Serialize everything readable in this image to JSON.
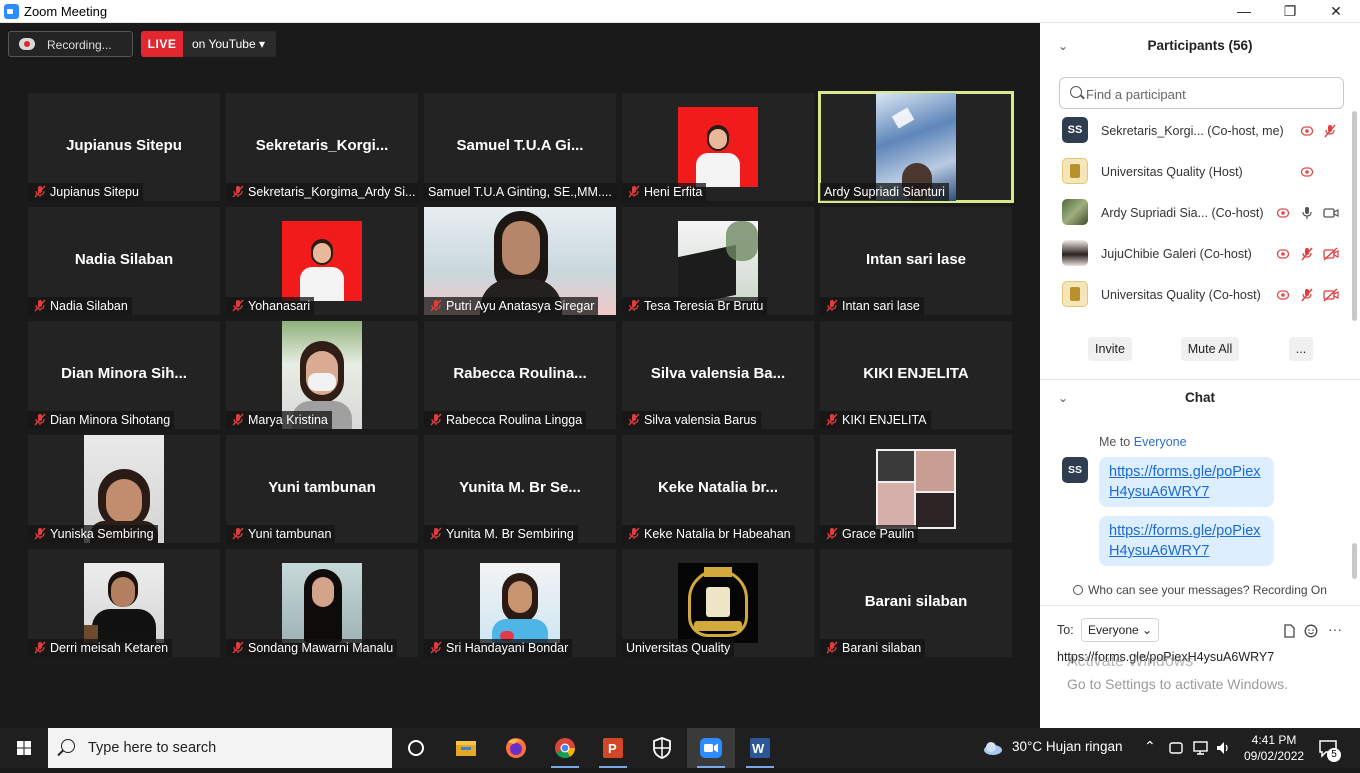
{
  "window": {
    "title": "Zoom Meeting",
    "minimize": "—",
    "maximize": "❐",
    "close": "✕"
  },
  "toolbar": {
    "recording_label": "Recording...",
    "live_badge": "LIVE",
    "live_target": "on YouTube ▾"
  },
  "tiles": [
    {
      "big": "Jupianus Sitepu",
      "label": "Jupianus Sitepu",
      "muted": true
    },
    {
      "big": "Sekretaris_Korgi...",
      "label": "Sekretaris_Korgima_Ardy Si...",
      "muted": true
    },
    {
      "big": "Samuel T.U.A Gi...",
      "label": "Samuel T.U.A Ginting, SE.,MM....",
      "muted": false
    },
    {
      "photo": "red-portrait",
      "label": "Heni Erfita",
      "muted": true
    },
    {
      "photo": "sky-video",
      "label": "Ardy Supriadi Sianturi",
      "muted": false,
      "active": true
    },
    {
      "big": "Nadia Silaban",
      "label": "Nadia Silaban",
      "muted": true
    },
    {
      "photo": "red-portrait",
      "label": "Yohanasari",
      "muted": true
    },
    {
      "photo": "webcam-girl",
      "label": "Putri Ayu Anatasya Siregar",
      "muted": true
    },
    {
      "photo": "building",
      "label": "Tesa Teresia Br Brutu",
      "muted": true
    },
    {
      "big": "Intan sari lase",
      "label": "Intan sari lase",
      "muted": true
    },
    {
      "big": "Dian Minora Sih...",
      "label": "Dian Minora Sihotang",
      "muted": true
    },
    {
      "photo": "masked-girl",
      "label": "Marya Kristina",
      "muted": true
    },
    {
      "big": "Rabecca Roulina...",
      "label": "Rabecca Roulina Lingga",
      "muted": true
    },
    {
      "big": "Silva valensia Ba...",
      "label": "Silva valensia Barus",
      "muted": true
    },
    {
      "big": "KIKI ENJELITA",
      "label": "KIKI ENJELITA",
      "muted": true
    },
    {
      "photo": "webcam-dark",
      "label": "Yuniska Sembiring",
      "muted": true
    },
    {
      "big": "Yuni tambunan",
      "label": "Yuni tambunan",
      "muted": true
    },
    {
      "big": "Yunita M. Br Se...",
      "label": "Yunita M. Br Sembiring",
      "muted": true
    },
    {
      "big": "Keke Natalia br...",
      "label": "Keke Natalia br Habeahan",
      "muted": true
    },
    {
      "photo": "collage",
      "label": "Grace Paulin",
      "muted": true
    },
    {
      "photo": "man-black",
      "label": "Derri meisah Ketaren",
      "muted": true
    },
    {
      "photo": "girl-dark",
      "label": "Sondang Mawarni Manalu",
      "muted": true
    },
    {
      "photo": "girl-blue",
      "label": "Sri Handayani Bondar",
      "muted": true
    },
    {
      "photo": "logo",
      "label": "Universitas Quality",
      "muted": false
    },
    {
      "big": "Barani silaban",
      "label": "Barani silaban",
      "muted": true
    }
  ],
  "participants": {
    "title": "Participants (56)",
    "search_placeholder": "Find a participant",
    "list": [
      {
        "avatar": "SS",
        "avatar_type": "initials",
        "name": "Sekretaris_Korgi...  (Co-host, me)",
        "icons": [
          "screen-share",
          "mic-muted"
        ]
      },
      {
        "avatar": "",
        "avatar_type": "logo",
        "name": "Universitas Quality (Host)",
        "icons": [
          "screen-share"
        ]
      },
      {
        "avatar": "",
        "avatar_type": "photo1",
        "name": "Ardy Supriadi Sia... (Co-host)",
        "icons": [
          "screen-share",
          "mic",
          "video"
        ]
      },
      {
        "avatar": "",
        "avatar_type": "photo2",
        "name": "JujuChibie Galeri (Co-host)",
        "icons": [
          "screen-share",
          "mic-muted",
          "video-off"
        ]
      },
      {
        "avatar": "",
        "avatar_type": "logo",
        "name": "Universitas Quality (Co-host)",
        "icons": [
          "screen-share",
          "mic-muted",
          "video-off"
        ]
      }
    ],
    "buttons": {
      "invite": "Invite",
      "mute_all": "Mute All",
      "more": "..."
    }
  },
  "chat": {
    "title": "Chat",
    "from": "Me to",
    "to_name": "Everyone",
    "sender_initials": "SS",
    "messages": [
      "https://forms.gle/poPiexH4ysuA6WRY7",
      "https://forms.gle/poPiexH4ysuA6WRY7"
    ],
    "visibility": "Who can see your messages? Recording On",
    "to_label": "To:",
    "to_value": "Everyone ⌄",
    "input_value": "https://forms.gle/poPiexH4ysuA6WRY7"
  },
  "watermark": {
    "line1": "Activate Windows",
    "line2": "Go to Settings to activate Windows."
  },
  "taskbar": {
    "search_placeholder": "Type here to search",
    "weather": "30°C  Hujan ringan",
    "time": "4:41 PM",
    "date": "09/02/2022",
    "notification_count": "5"
  }
}
